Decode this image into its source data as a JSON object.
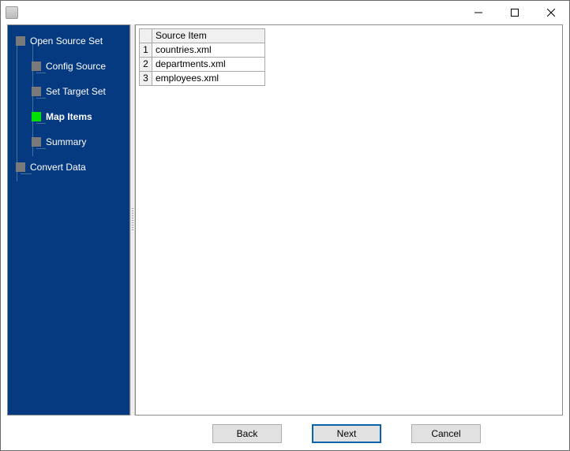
{
  "window": {
    "title": ""
  },
  "sidebar": {
    "items": [
      {
        "label": "Open Source Set",
        "level": 0
      },
      {
        "label": "Config Source",
        "level": 1
      },
      {
        "label": "Set Target Set",
        "level": 1
      },
      {
        "label": "Map Items",
        "level": 1
      },
      {
        "label": "Summary",
        "level": 1
      },
      {
        "label": "Convert Data",
        "level": 0
      }
    ],
    "active_index": 3
  },
  "table": {
    "header": "Source Item",
    "rows": [
      {
        "n": "1",
        "value": "countries.xml"
      },
      {
        "n": "2",
        "value": "departments.xml"
      },
      {
        "n": "3",
        "value": "employees.xml"
      }
    ]
  },
  "footer": {
    "back": "Back",
    "next": "Next",
    "cancel": "Cancel"
  }
}
